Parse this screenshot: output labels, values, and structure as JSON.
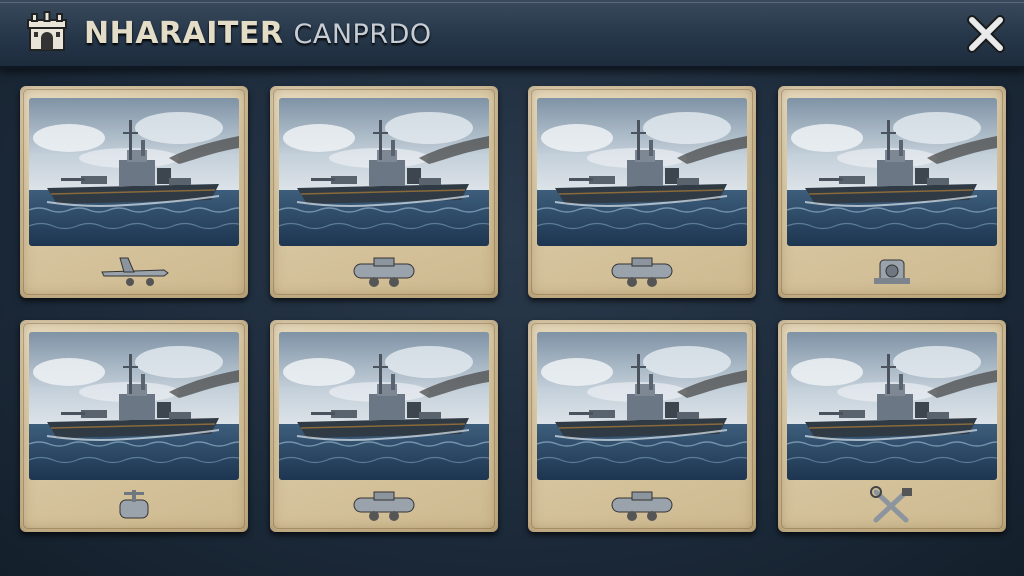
{
  "header": {
    "title_bold": "NHARAITER",
    "title_light": "CANPRDO",
    "icon": "fortress-icon",
    "close_icon": "close-icon"
  },
  "cards": [
    {
      "ship": "battleship",
      "module_icon": "aircraft-module-icon"
    },
    {
      "ship": "battleship",
      "module_icon": "turret-module-icon"
    },
    {
      "ship": "battleship",
      "module_icon": "turret-module-icon"
    },
    {
      "ship": "battleship",
      "module_icon": "engine-module-icon"
    },
    {
      "ship": "battleship",
      "module_icon": "gun-mount-module-icon"
    },
    {
      "ship": "battleship",
      "module_icon": "turret-module-icon"
    },
    {
      "ship": "battleship",
      "module_icon": "turret-module-icon"
    },
    {
      "ship": "battleship",
      "module_icon": "repair-tools-icon"
    }
  ],
  "colors": {
    "header": "#26374a",
    "parchment": "#d8c7a2",
    "sea": "#2c4a66",
    "sky": "#c9d6e0",
    "hull": "#3a4450"
  }
}
